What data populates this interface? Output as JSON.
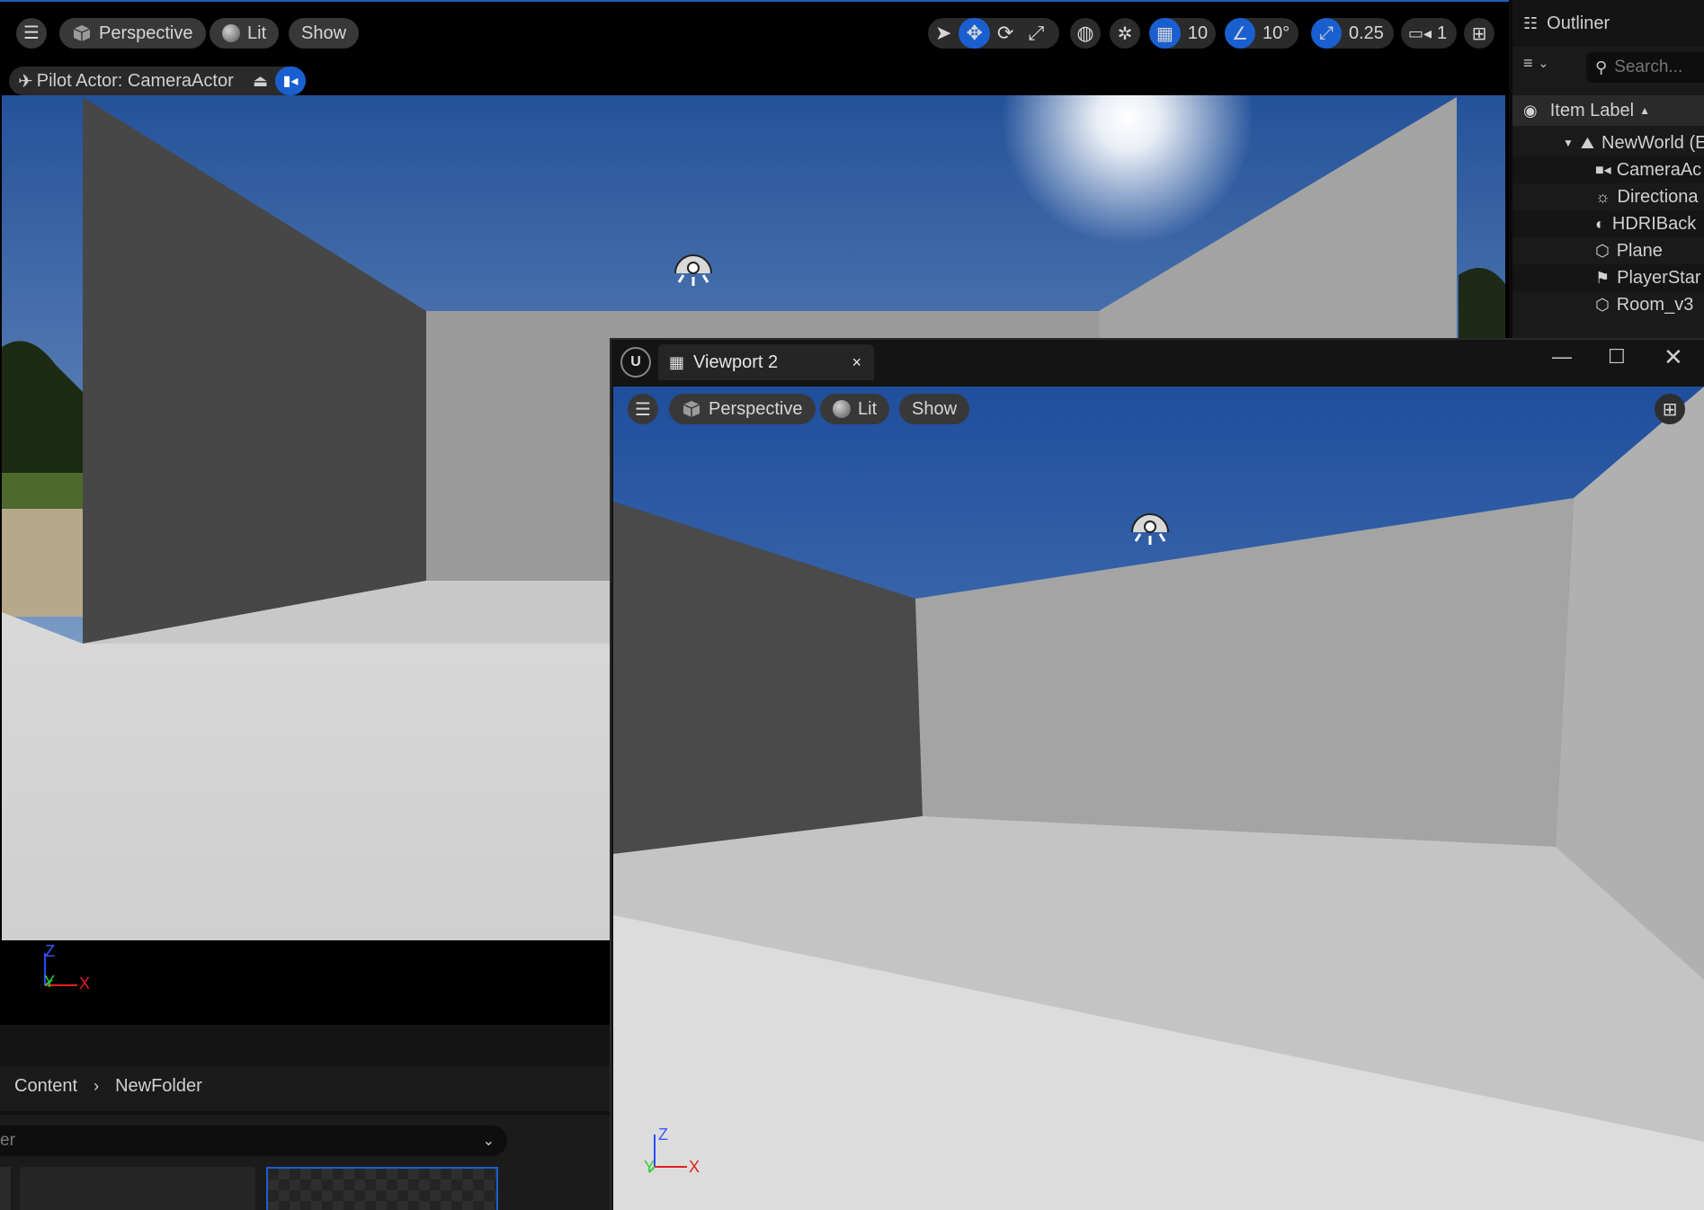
{
  "main_viewport": {
    "toolbar": {
      "view_mode_label": "Perspective",
      "lighting_label": "Lit",
      "show_label": "Show",
      "grid_snap_value": "10",
      "rotation_snap_value": "10°",
      "scale_snap_value": "0.25",
      "camera_speed_value": "1"
    },
    "pilot_bar": {
      "label": "Pilot Actor: CameraActor"
    },
    "axis": {
      "z": "Z",
      "y": "Y",
      "x": "X"
    },
    "colors": {
      "accent": "#1a5fd0",
      "sky_top": "#2a5ea8",
      "sky_bottom": "#9bb6d6"
    }
  },
  "outliner": {
    "title": "Outliner",
    "search_placeholder": "Search...",
    "column_label": "Item Label",
    "items": [
      {
        "label": "NewWorld (E",
        "icon": "world-icon"
      },
      {
        "label": "CameraAc",
        "icon": "camera-icon"
      },
      {
        "label": "Directiona",
        "icon": "directional-light-icon"
      },
      {
        "label": "HDRIBack",
        "icon": "hdri-icon"
      },
      {
        "label": "Plane",
        "icon": "mesh-icon"
      },
      {
        "label": "PlayerStar",
        "icon": "player-start-icon"
      },
      {
        "label": "Room_v3",
        "icon": "mesh-icon"
      }
    ]
  },
  "content_browser": {
    "breadcrumb": [
      "Content",
      "NewFolder"
    ],
    "filter_text": "er"
  },
  "viewport2": {
    "tab_label": "Viewport 2",
    "toolbar": {
      "view_mode_label": "Perspective",
      "lighting_label": "Lit",
      "show_label": "Show"
    },
    "axis": {
      "z": "Z",
      "y": "Y",
      "x": "X"
    }
  }
}
